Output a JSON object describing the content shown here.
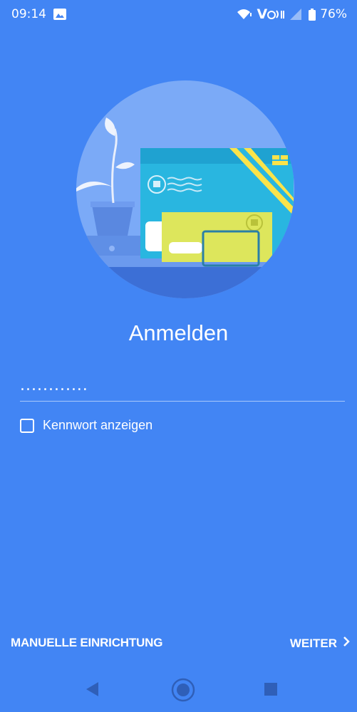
{
  "status_bar": {
    "time": "09:14",
    "battery": "76%",
    "volte_label": "V"
  },
  "login": {
    "title": "Anmelden",
    "password_value": "............",
    "show_password_label": "Kennwort anzeigen",
    "show_password_checked": false
  },
  "actions": {
    "manual_setup_label": "MANUELLE EINRICHTUNG",
    "next_label": "WEITER"
  },
  "icons": {
    "status": [
      "image-icon",
      "wifi-icon",
      "volte-icon",
      "signal-icon",
      "battery-icon"
    ],
    "next": "chevron-right-icon",
    "nav": [
      "back-icon",
      "home-icon",
      "recents-icon"
    ]
  },
  "colors": {
    "background": "#4285f4",
    "illustration_circle": "#7baaf7",
    "card_blue": "#29b6e0",
    "card_yellow": "#dde65c",
    "accent_yellow": "#fbe34a"
  }
}
